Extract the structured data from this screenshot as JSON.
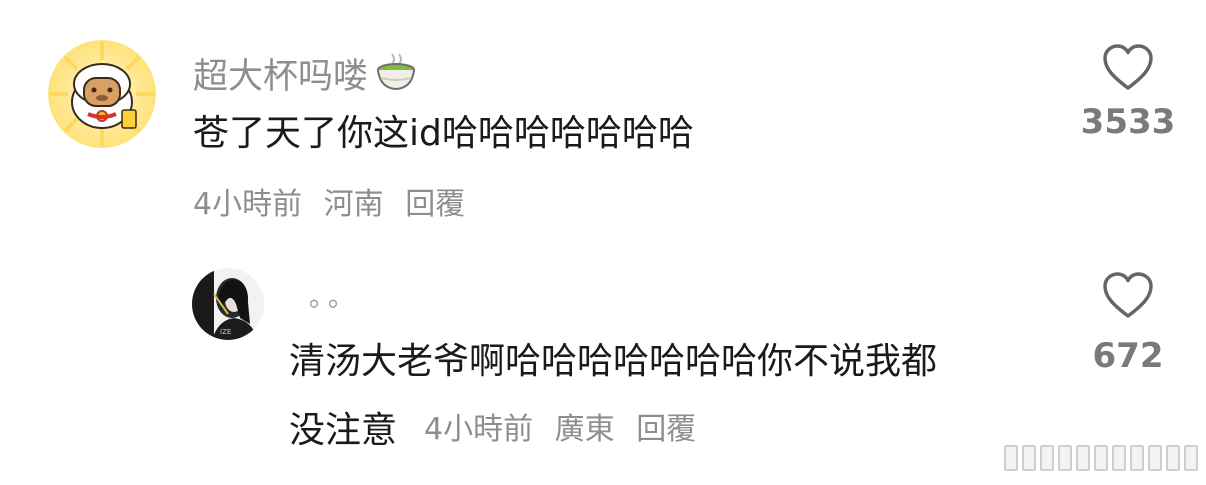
{
  "comment": {
    "username": "超大杯吗喽",
    "username_emoji_icon": "green-tea-icon",
    "text": "苍了天了你这id哈哈哈哈哈哈哈",
    "time": "4小時前",
    "location": "河南",
    "reply_label": "回覆",
    "like_icon": "heart-outline-icon",
    "like_count": "3533",
    "avatar_icon": "capybara-avatar"
  },
  "reply": {
    "username": "。。",
    "text_line1": "清汤大老爷啊哈哈哈哈哈哈哈你不说我都",
    "text_line2": "没注意",
    "time": "4小時前",
    "location": "廣東",
    "reply_label": "回覆",
    "like_icon": "heart-outline-icon",
    "like_count": "672",
    "avatar_icon": "photo-avatar"
  },
  "colors": {
    "text_primary": "#1a1a1a",
    "text_secondary": "#8e8e8e",
    "heart_stroke": "#666666"
  }
}
